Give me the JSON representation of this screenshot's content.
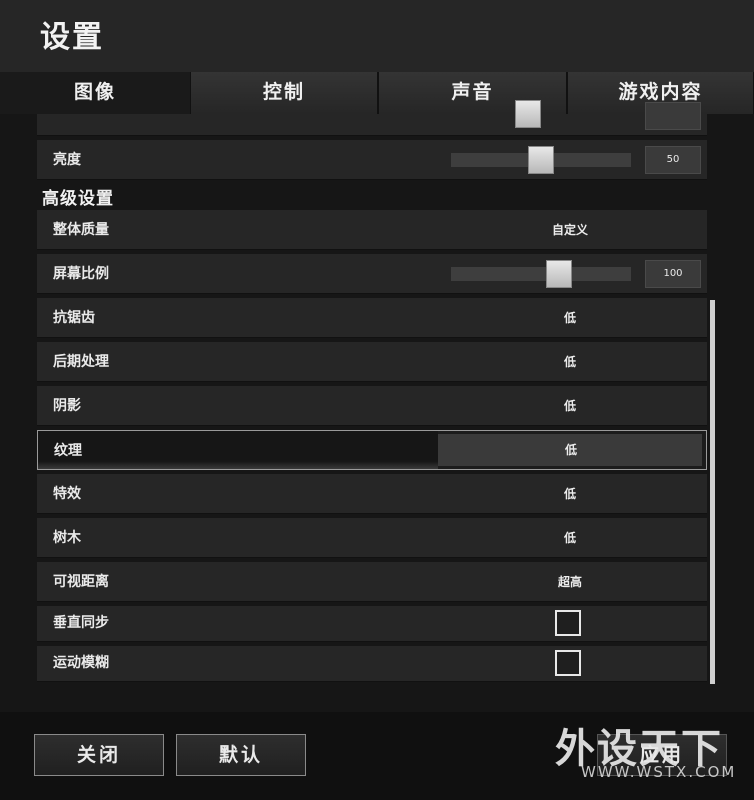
{
  "header": {
    "title": "设置"
  },
  "tabs": [
    {
      "label": "图像",
      "active": true
    },
    {
      "label": "控制"
    },
    {
      "label": "声音"
    },
    {
      "label": "游戏内容"
    }
  ],
  "settings": {
    "brightness": {
      "label": "亮度",
      "value": "50",
      "fraction": 0.5
    },
    "advanced_title": "高级设置",
    "overall_quality": {
      "label": "整体质量",
      "value": "自定义"
    },
    "screen_ratio": {
      "label": "屏幕比例",
      "value": "100",
      "fraction": 0.6
    },
    "anti_aliasing": {
      "label": "抗锯齿",
      "value": "低"
    },
    "post_processing": {
      "label": "后期处理",
      "value": "低"
    },
    "shadows": {
      "label": "阴影",
      "value": "低"
    },
    "textures": {
      "label": "纹理",
      "value": "低"
    },
    "effects": {
      "label": "特效",
      "value": "低"
    },
    "foliage": {
      "label": "树木",
      "value": "低"
    },
    "view_distance": {
      "label": "可视距离",
      "value": "超高"
    },
    "vsync": {
      "label": "垂直同步",
      "checked": false
    },
    "motion_blur": {
      "label": "运动模糊",
      "checked": false
    }
  },
  "footer": {
    "close_label": "关闭",
    "default_label": "默认",
    "apply_label": "应用"
  },
  "watermark": {
    "text": "外设天下",
    "url": "WWW.WSTX.COM"
  }
}
